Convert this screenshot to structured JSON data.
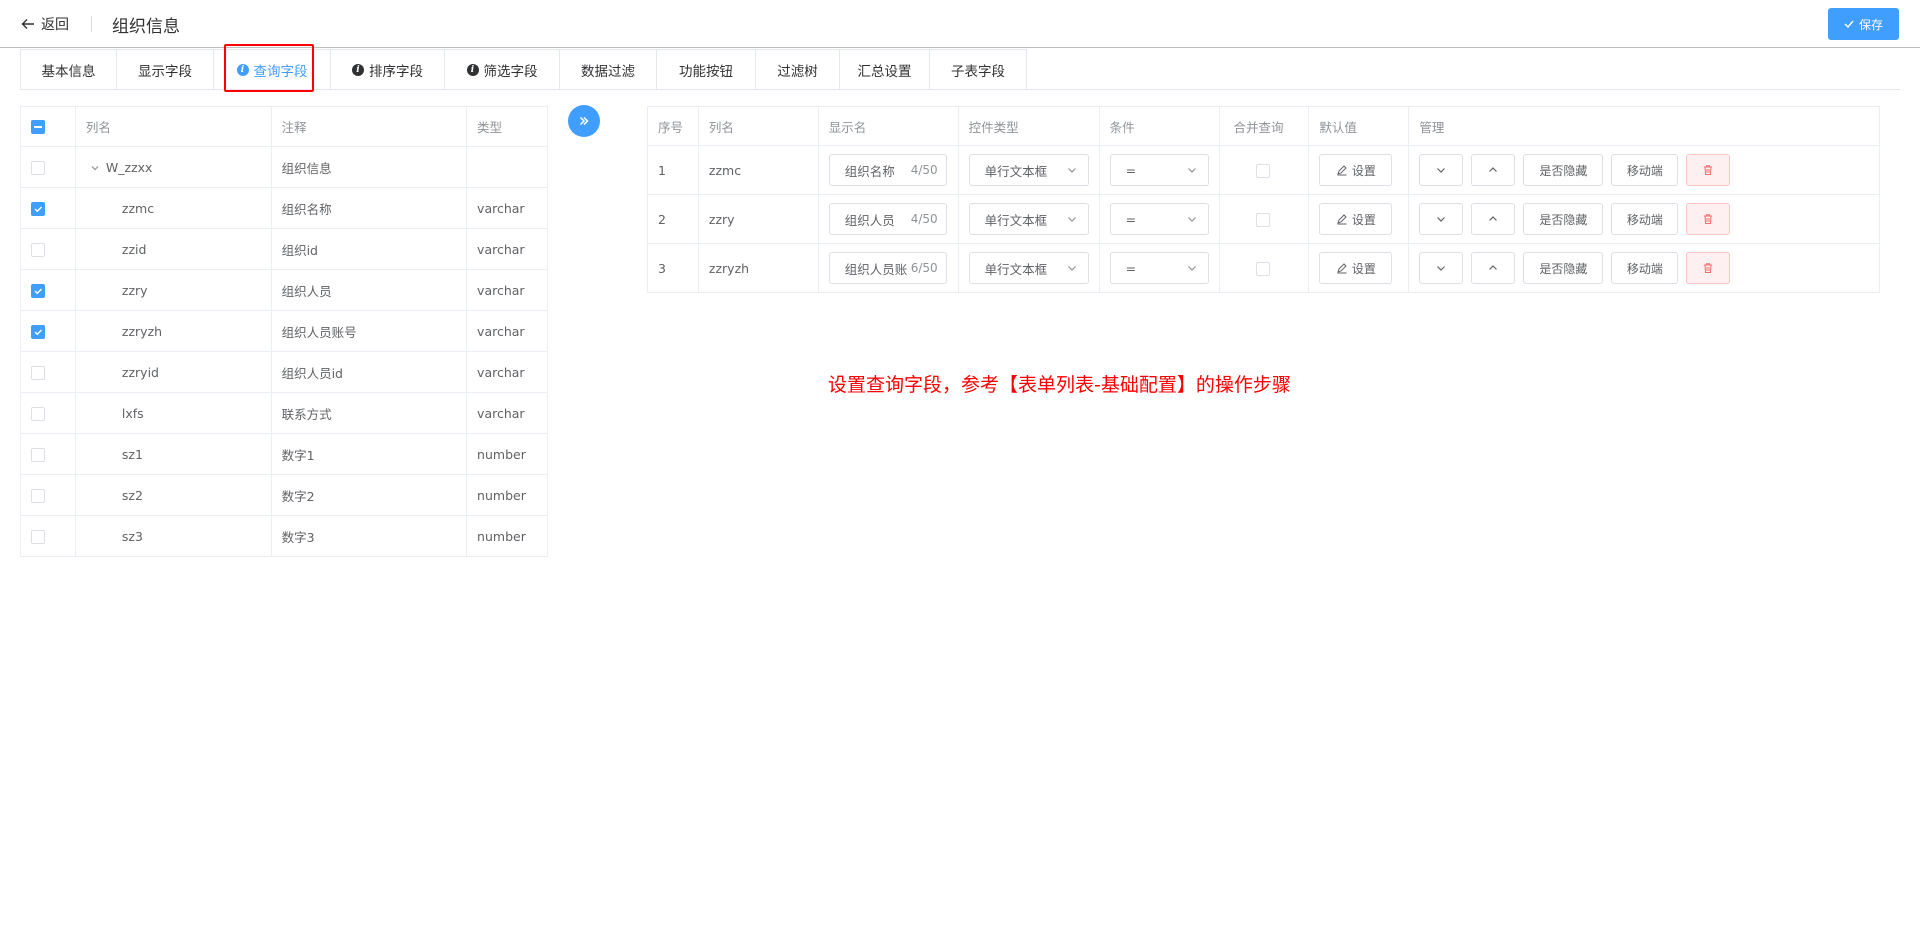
{
  "header": {
    "back_label": "返回",
    "title": "组织信息",
    "save_label": "保存"
  },
  "tabs": [
    {
      "label": "基本信息",
      "icon": false,
      "active": false
    },
    {
      "label": "显示字段",
      "icon": false,
      "active": false
    },
    {
      "label": "查询字段",
      "icon": true,
      "active": true
    },
    {
      "label": "排序字段",
      "icon": true,
      "active": false
    },
    {
      "label": "筛选字段",
      "icon": true,
      "active": false
    },
    {
      "label": "数据过滤",
      "icon": false,
      "active": false
    },
    {
      "label": "功能按钮",
      "icon": false,
      "active": false
    },
    {
      "label": "过滤树",
      "icon": false,
      "active": false
    },
    {
      "label": "汇总设置",
      "icon": false,
      "active": false
    },
    {
      "label": "子表字段",
      "icon": false,
      "active": false
    }
  ],
  "left_table": {
    "headers": [
      "列名",
      "注释",
      "类型"
    ],
    "rows": [
      {
        "name": "W_zzxx",
        "comment": "组织信息",
        "type": "",
        "checked": false
      },
      {
        "name": "zzmc",
        "comment": "组织名称",
        "type": "varchar",
        "checked": true
      },
      {
        "name": "zzid",
        "comment": "组织id",
        "type": "varchar",
        "checked": false
      },
      {
        "name": "zzry",
        "comment": "组织人员",
        "type": "varchar",
        "checked": true
      },
      {
        "name": "zzryzh",
        "comment": "组织人员账号",
        "type": "varchar",
        "checked": true
      },
      {
        "name": "zzryid",
        "comment": "组织人员id",
        "type": "varchar",
        "checked": false
      },
      {
        "name": "lxfs",
        "comment": "联系方式",
        "type": "varchar",
        "checked": false
      },
      {
        "name": "sz1",
        "comment": "数字1",
        "type": "number",
        "checked": false
      },
      {
        "name": "sz2",
        "comment": "数字2",
        "type": "number",
        "checked": false
      },
      {
        "name": "sz3",
        "comment": "数字3",
        "type": "number",
        "checked": false
      }
    ]
  },
  "right_table": {
    "headers": [
      "序号",
      "列名",
      "显示名",
      "控件类型",
      "条件",
      "合并查询",
      "默认值",
      "管理"
    ],
    "rows": [
      {
        "index": "1",
        "name": "zzmc",
        "display": "组织名称",
        "count": "4/50",
        "control": "单行文本框",
        "condition": "=",
        "default_label": "设置"
      },
      {
        "index": "2",
        "name": "zzry",
        "display": "组织人员",
        "count": "4/50",
        "control": "单行文本框",
        "condition": "=",
        "default_label": "设置"
      },
      {
        "index": "3",
        "name": "zzryzh",
        "display": "组织人员账号",
        "count": "6/50",
        "control": "单行文本框",
        "condition": "=",
        "default_label": "设置"
      }
    ],
    "hide_label": "是否隐藏",
    "move_label": "移动端"
  },
  "note": "设置查询字段，参考【表单列表-基础配置】的操作步骤",
  "colors": {
    "primary": "#409eff",
    "highlight": "#ff0000"
  }
}
